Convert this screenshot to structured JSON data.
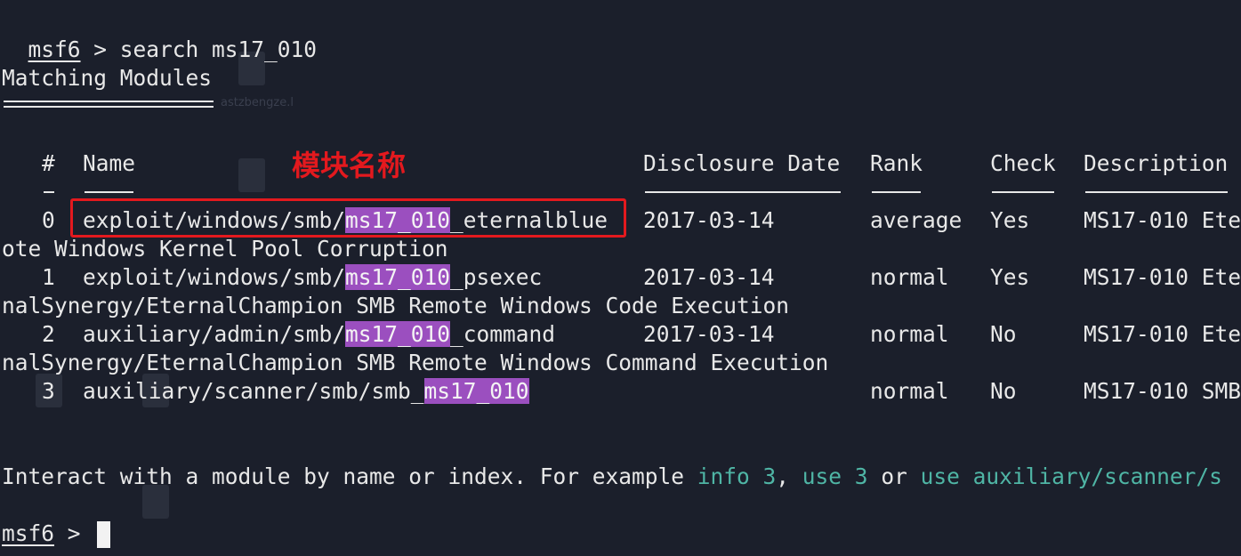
{
  "prompt": "msf6",
  "prompt_sep": " > ",
  "command": "search ms17_010",
  "heading": "Matching Modules",
  "annotation_label": "模块名称",
  "table": {
    "headers": {
      "num": "#",
      "name": "Name",
      "date": "Disclosure Date",
      "rank": "Rank",
      "check": "Check",
      "desc": "Description"
    },
    "rows": [
      {
        "num": "0",
        "prefix": "exploit/windows/smb/",
        "hl": "ms17_010",
        "suffix": "_eternalblue",
        "date": "2017-03-14",
        "rank": "average",
        "check": "Yes",
        "desc": "MS17-010 Ete",
        "wrap": "ote Windows Kernel Pool Corruption"
      },
      {
        "num": "1",
        "prefix": "exploit/windows/smb/",
        "hl": "ms17_010",
        "suffix": "_psexec",
        "date": "2017-03-14",
        "rank": "normal",
        "check": "Yes",
        "desc": "MS17-010 Ete",
        "wrap": "nalSynergy/EternalChampion SMB Remote Windows Code Execution"
      },
      {
        "num": "2",
        "prefix": "auxiliary/admin/smb/",
        "hl": "ms17_010",
        "suffix": "_command",
        "date": "2017-03-14",
        "rank": "normal",
        "check": "No",
        "desc": "MS17-010 Ete",
        "wrap": "nalSynergy/EternalChampion SMB Remote Windows Command Execution"
      },
      {
        "num": "3",
        "prefix": "auxiliary/scanner/smb/smb_",
        "hl": "ms17_010",
        "suffix": "",
        "date": "",
        "rank": "normal",
        "check": "No",
        "desc": "MS17-010 SMB",
        "wrap": ""
      }
    ]
  },
  "footer": {
    "text1": "Interact with a module by name or index. For example ",
    "link1": "info 3",
    "text2": ", ",
    "link2": "use 3",
    "text3": " or ",
    "link3": "use auxiliary/scanner/s"
  },
  "colors": {
    "background": "#1b1f2b",
    "highlight": "#9b4fbf",
    "annotation": "#e3191e",
    "link": "#4fb5a5"
  }
}
